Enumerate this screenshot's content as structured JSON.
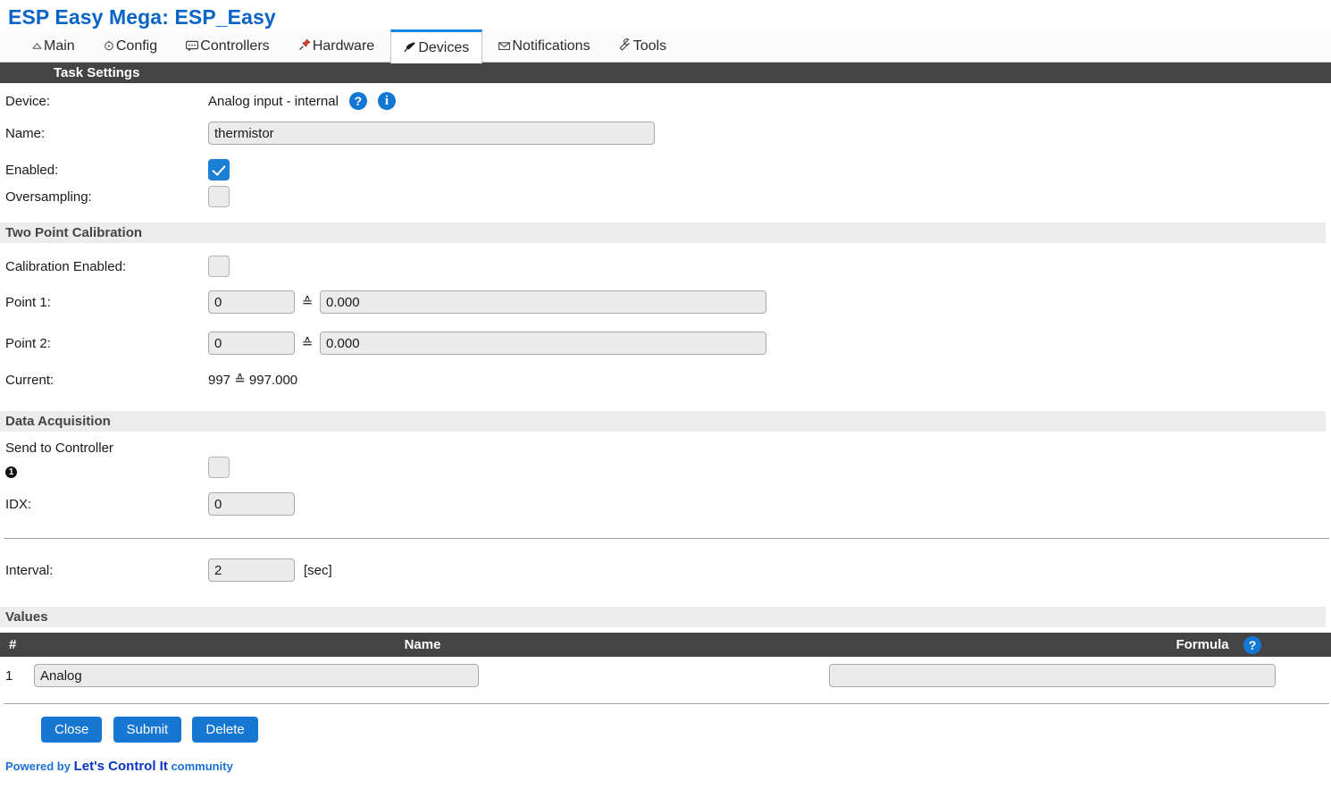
{
  "page": {
    "title": "ESP Easy Mega: ESP_Easy"
  },
  "tabs": [
    {
      "label": "Main",
      "icon": "home-icon",
      "glyph": "⌂",
      "active": false
    },
    {
      "label": "Config",
      "icon": "gear-icon",
      "glyph": "⊙",
      "active": false
    },
    {
      "label": "Controllers",
      "icon": "chat-bubble-icon",
      "glyph": "💬",
      "active": false
    },
    {
      "label": "Hardware",
      "icon": "pushpin-icon",
      "glyph": "📌",
      "active": false
    },
    {
      "label": "Devices",
      "icon": "plug-icon",
      "glyph": "🔌",
      "active": true
    },
    {
      "label": "Notifications",
      "icon": "envelope-icon",
      "glyph": "✉",
      "active": false
    },
    {
      "label": "Tools",
      "icon": "wrench-icon",
      "glyph": "🔧",
      "active": false
    }
  ],
  "task_settings": {
    "header": "Task Settings",
    "device_label": "Device:",
    "device_value": "Analog input - internal",
    "name_label": "Name:",
    "name_value": "thermistor",
    "enabled_label": "Enabled:",
    "enabled_checked": true,
    "oversampling_label": "Oversampling:",
    "oversampling_checked": false
  },
  "calibration": {
    "header": "Two Point Calibration",
    "enabled_label": "Calibration Enabled:",
    "enabled_checked": false,
    "point1_label": "Point 1:",
    "point1_raw": "0",
    "point1_value": "0.000",
    "point2_label": "Point 2:",
    "point2_raw": "0",
    "point2_value": "0.000",
    "current_label": "Current:",
    "current_value": "997 ≙ 997.000",
    "equals_symbol": "≙"
  },
  "data_acquisition": {
    "header": "Data Acquisition",
    "send_to_controller_label": "Send to Controller",
    "controller_index": "1",
    "send_to_controller_checked": false,
    "idx_label": "IDX:",
    "idx_value": "0"
  },
  "interval": {
    "label": "Interval:",
    "value": "2",
    "unit": "[sec]"
  },
  "values": {
    "header": "Values",
    "columns": {
      "number": "#",
      "name": "Name",
      "formula": "Formula"
    },
    "rows": [
      {
        "number": "1",
        "name": "Analog",
        "formula": ""
      }
    ]
  },
  "buttons": {
    "close": "Close",
    "submit": "Submit",
    "delete": "Delete"
  },
  "footer": {
    "prefix": "Powered by",
    "brand": "Let's Control It",
    "suffix": "community"
  },
  "colors": {
    "title_blue": "#0a64c8",
    "accent_blue": "#1577d1",
    "tab_active_top": "#1a85e0",
    "dark_bar": "#444444",
    "grey_bar": "#ececec",
    "input_bg": "#ebebeb"
  }
}
